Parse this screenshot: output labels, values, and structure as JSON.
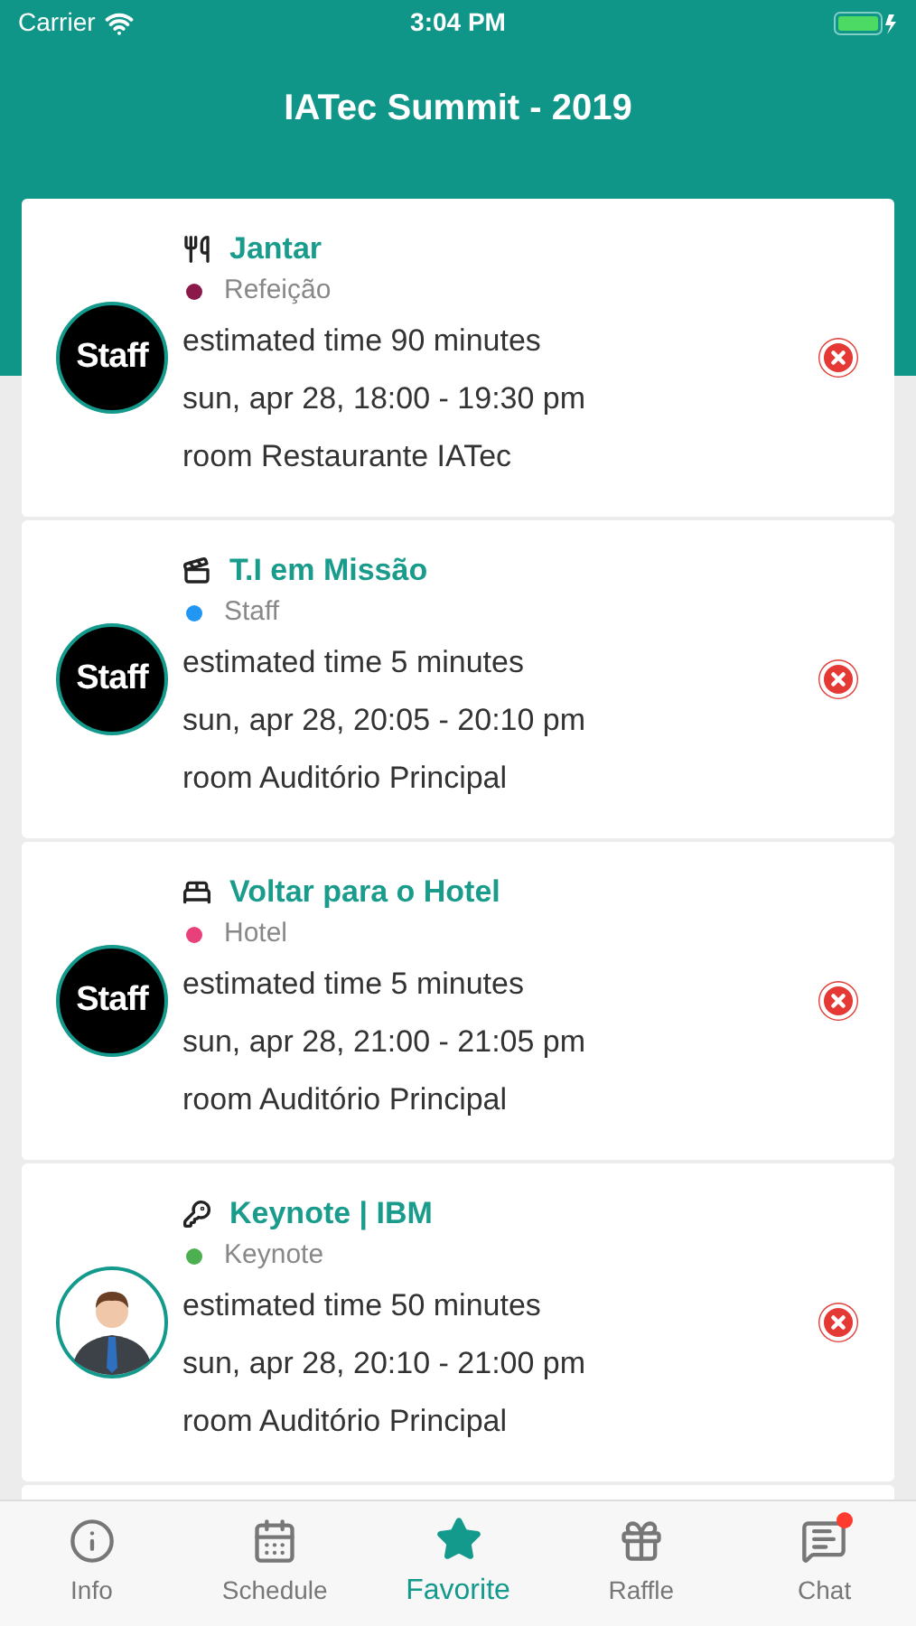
{
  "status_bar": {
    "carrier": "Carrier",
    "time": "3:04 PM"
  },
  "header": {
    "title": "IATec Summit - 2019"
  },
  "events": [
    {
      "kind": "food",
      "title": "Jantar",
      "category": "Refeição",
      "color": "#8b1a4a",
      "avatar": {
        "kind": "text",
        "text": "Staff"
      },
      "duration": "estimated time 90 minutes",
      "when": "sun, apr 28, 18:00 - 19:30 pm",
      "room": "room Restaurante IATec"
    },
    {
      "kind": "film",
      "title": "T.I em Missão",
      "category": "Staff",
      "color": "#2196f3",
      "avatar": {
        "kind": "text",
        "text": "Staff"
      },
      "duration": "estimated time 5 minutes",
      "when": "sun, apr 28, 20:05 - 20:10 pm",
      "room": "room Auditório Principal"
    },
    {
      "kind": "bed",
      "title": "Voltar para o Hotel",
      "category": "Hotel",
      "color": "#e8407a",
      "avatar": {
        "kind": "text",
        "text": "Staff"
      },
      "duration": "estimated time 5 minutes",
      "when": "sun, apr 28, 21:00 - 21:05 pm",
      "room": "room Auditório Principal"
    },
    {
      "kind": "key",
      "title": "Keynote | IBM",
      "category": "Keynote",
      "color": "#4caf50",
      "avatar": {
        "kind": "person"
      },
      "duration": "estimated time 50 minutes",
      "when": "sun, apr 28, 20:10 - 21:00 pm",
      "room": "room Auditório Principal"
    }
  ],
  "tabs": [
    {
      "kind": "info",
      "label": "Info",
      "selected": false,
      "badge": false
    },
    {
      "kind": "calendar",
      "label": "Schedule",
      "selected": false,
      "badge": false
    },
    {
      "kind": "star",
      "label": "Favorite",
      "selected": true,
      "badge": false
    },
    {
      "kind": "gift",
      "label": "Raffle",
      "selected": false,
      "badge": false
    },
    {
      "kind": "chat",
      "label": "Chat",
      "selected": false,
      "badge": true
    }
  ]
}
